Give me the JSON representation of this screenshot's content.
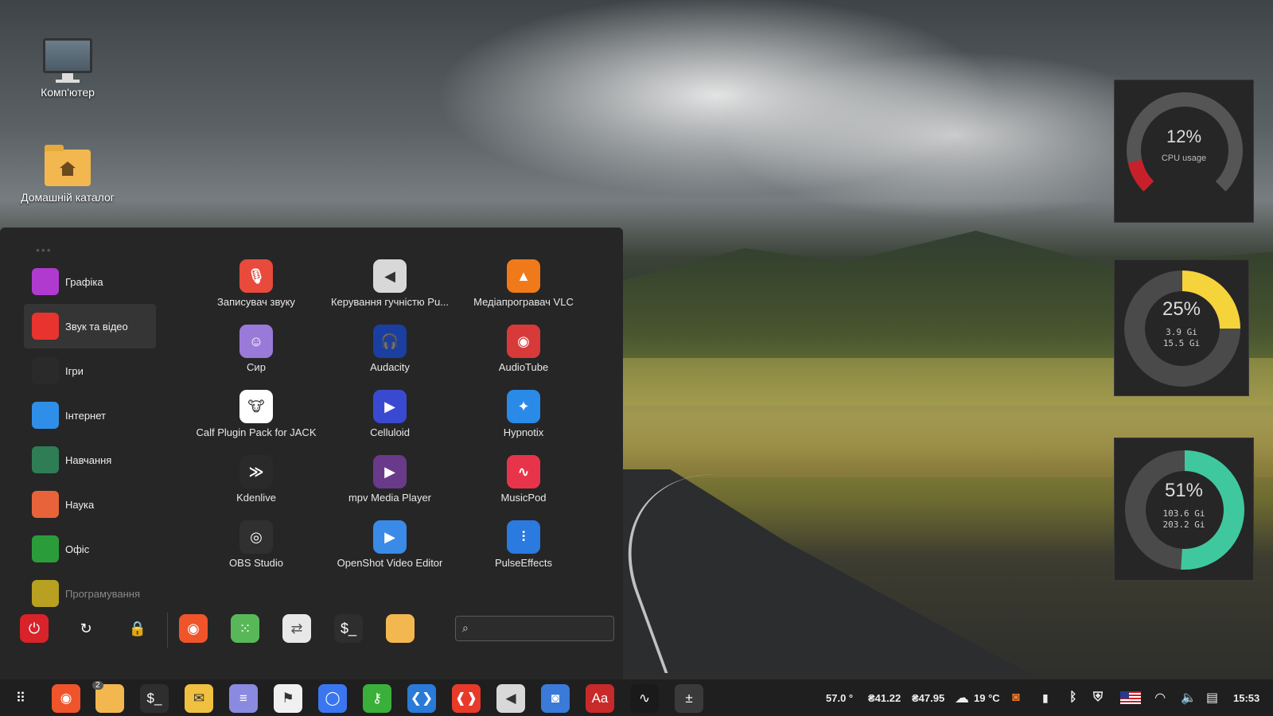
{
  "desktop": {
    "icons": [
      {
        "label": "Комп'ютер"
      },
      {
        "label": "Домашній каталог"
      }
    ]
  },
  "widgets": {
    "cpu": {
      "percent_text": "12%",
      "label": "CPU usage",
      "value": 12,
      "color": "#c8202a"
    },
    "memory": {
      "percent_text": "25%",
      "used": "3.9 Gi",
      "total": "15.5 Gi",
      "value": 25,
      "color": "#f5d33a"
    },
    "disk": {
      "percent_text": "51%",
      "used": "103.6 Gi",
      "total": "203.2 Gi",
      "value": 51,
      "color": "#3fc89e"
    }
  },
  "menu": {
    "categories": [
      {
        "label": "Графіка",
        "icon": "graphics-icon",
        "color": "#b03ad0",
        "active": false
      },
      {
        "label": "Звук та відео",
        "icon": "play-icon",
        "color": "#e8332f",
        "active": true
      },
      {
        "label": "Ігри",
        "icon": "invader-icon",
        "color": "#2a2a2a",
        "active": false
      },
      {
        "label": "Інтернет",
        "icon": "cloud-icon",
        "color": "#2f8fe8",
        "active": false
      },
      {
        "label": "Навчання",
        "icon": "abc-icon",
        "color": "#2e7d55",
        "active": false
      },
      {
        "label": "Наука",
        "icon": "atom-icon",
        "color": "#e8633a",
        "active": false
      },
      {
        "label": "Офіс",
        "icon": "document-icon",
        "color": "#2a9d3a",
        "active": false
      },
      {
        "label": "Програмування",
        "icon": "code-icon",
        "color": "#b8a020",
        "active": false
      }
    ],
    "apps": [
      {
        "label": "Записувач звуку",
        "icon": "microphone-icon",
        "color": "#e84a3c",
        "glyph": "🎙"
      },
      {
        "label": "Керування гучністю Pu...",
        "icon": "speaker-icon",
        "color": "#d8d8d8",
        "glyph": "◀"
      },
      {
        "label": "Медіапрогравач VLC",
        "icon": "vlc-icon",
        "color": "#f07a1a",
        "glyph": "▲"
      },
      {
        "label": "Сир",
        "icon": "cheese-icon",
        "color": "#9a7ad8",
        "glyph": "☺"
      },
      {
        "label": "Audacity",
        "icon": "audacity-icon",
        "color": "#1b3fa0",
        "glyph": "🎧"
      },
      {
        "label": "AudioTube",
        "icon": "audiotube-icon",
        "color": "#d83a3a",
        "glyph": "◉"
      },
      {
        "label": "Calf Plugin Pack for JACK",
        "icon": "calf-icon",
        "color": "#ffffff",
        "glyph": "🐮"
      },
      {
        "label": "Celluloid",
        "icon": "celluloid-icon",
        "color": "#3a4ad0",
        "glyph": "▶"
      },
      {
        "label": "Hypnotix",
        "icon": "hypnotix-icon",
        "color": "#2a8ae8",
        "glyph": "✦"
      },
      {
        "label": "Kdenlive",
        "icon": "kdenlive-icon",
        "color": "#2a2a2a",
        "glyph": "≫"
      },
      {
        "label": "mpv Media Player",
        "icon": "mpv-icon",
        "color": "#6a3a8a",
        "glyph": "▶"
      },
      {
        "label": "MusicPod",
        "icon": "musicpod-icon",
        "color": "#e8344a",
        "glyph": "∿"
      },
      {
        "label": "OBS Studio",
        "icon": "obs-icon",
        "color": "#303030",
        "glyph": "◎"
      },
      {
        "label": "OpenShot Video Editor",
        "icon": "openshot-icon",
        "color": "#3a8ae8",
        "glyph": "▶"
      },
      {
        "label": "PulseEffects",
        "icon": "pulseeffects-icon",
        "color": "#2a7ae0",
        "glyph": "⫶"
      }
    ],
    "bottom_buttons": [
      {
        "name": "power-button",
        "icon": "power-icon",
        "color": "#d8232a",
        "glyph": "⏻"
      },
      {
        "name": "restart-button",
        "icon": "restart-icon",
        "color": "#262626",
        "glyph": "↻"
      },
      {
        "name": "lock-button",
        "icon": "lock-icon",
        "color": "#262626",
        "glyph": "🔒"
      },
      {
        "name": "firefox-button",
        "icon": "firefox-icon",
        "color": "#f0542a",
        "glyph": "◉"
      },
      {
        "name": "apps-button",
        "icon": "grid-icon",
        "color": "#58b858",
        "glyph": "⁙"
      },
      {
        "name": "settings-button",
        "icon": "toggle-icon",
        "color": "#e8e8e8",
        "glyph": "⇄"
      },
      {
        "name": "terminal-button",
        "icon": "terminal-icon",
        "color": "#2e2e2e",
        "glyph": "$_"
      },
      {
        "name": "files-button",
        "icon": "folder-icon",
        "color": "#f3b74f",
        "glyph": ""
      }
    ],
    "search_placeholder": ""
  },
  "taskbar": {
    "items": [
      {
        "name": "app-grid-button",
        "icon": "app-grid-icon",
        "color": "#1f1f1f",
        "glyph": "⠿"
      },
      {
        "name": "firefox",
        "icon": "firefox-icon",
        "color": "#f0542a",
        "glyph": "◉"
      },
      {
        "name": "files",
        "icon": "folder-icon",
        "color": "#f3b74f",
        "glyph": "",
        "badge": "2"
      },
      {
        "name": "terminal",
        "icon": "terminal-icon",
        "color": "#2e2e2e",
        "glyph": "$_"
      },
      {
        "name": "mail",
        "icon": "mail-icon",
        "color": "#f0c040",
        "glyph": "✉"
      },
      {
        "name": "text-editor",
        "icon": "text-editor-icon",
        "color": "#8a8ae0",
        "glyph": "≡"
      },
      {
        "name": "flatseal",
        "icon": "flag-icon",
        "color": "#f0f0f0",
        "glyph": "⚑"
      },
      {
        "name": "signal",
        "icon": "chat-icon",
        "color": "#3a76f0",
        "glyph": "◯"
      },
      {
        "name": "passwords",
        "icon": "key-icon",
        "color": "#3ab03a",
        "glyph": "⚷"
      },
      {
        "name": "vscode",
        "icon": "code-icon",
        "color": "#2a7ad8",
        "glyph": "❮❯"
      },
      {
        "name": "anydesk",
        "icon": "remote-icon",
        "color": "#e83a2a",
        "glyph": "❰❱"
      },
      {
        "name": "volume-control",
        "icon": "speaker-icon",
        "color": "#d8d8d8",
        "glyph": "◀"
      },
      {
        "name": "screenshot",
        "icon": "camera-icon",
        "color": "#3a7ad8",
        "glyph": "◙"
      },
      {
        "name": "dictionary",
        "icon": "dictionary-icon",
        "color": "#c82a2a",
        "glyph": "Aa"
      },
      {
        "name": "system-monitor",
        "icon": "activity-icon",
        "color": "#1a1a1a",
        "glyph": "∿"
      },
      {
        "name": "calculator",
        "icon": "calculator-icon",
        "color": "#3a3a3a",
        "glyph": "±"
      }
    ],
    "tray": {
      "temp": "57.0 °",
      "price1": "₴41.22",
      "price2": "₴47.95",
      "weather": "19 °C",
      "clock": "15:53"
    }
  }
}
